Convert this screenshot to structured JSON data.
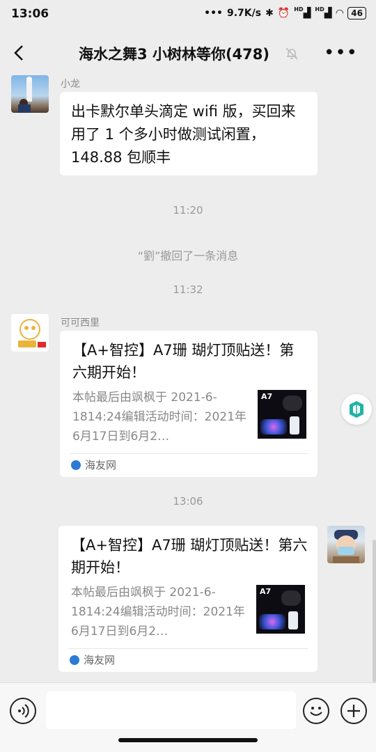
{
  "status_bar": {
    "time": "13:06",
    "network_speed": "9.7K/s",
    "hd1": "HD",
    "hd2": "HD",
    "battery": "46"
  },
  "header": {
    "title": "海水之舞3 小树林等你(478)"
  },
  "messages": {
    "m1": {
      "sender": "小龙",
      "text": "出卡默尔单头滴定 wifi 版，买回来用了 1 个多小时做测试闲置，148.88 包顺丰"
    },
    "t1": "11:20",
    "recall": "“劉”撤回了一条消息",
    "t2": "11:32",
    "m2": {
      "sender": "可可西里",
      "card_title": "【A+智控】A7珊 瑚灯顶贴送！第六期开始！",
      "card_desc": "本帖最后由飒枫于 2021-6-1814:24编辑活动时间：2021年6月17日到6月2…",
      "thumb_label": "A7",
      "source": "海友网"
    },
    "t3": "13:06",
    "m3": {
      "card_title": "【A+智控】A7珊 瑚灯顶贴送！第六期开始！",
      "card_desc": "本帖最后由飒枫于 2021-6-1814:24编辑活动时间：2021年6月17日到6月2…",
      "thumb_label": "A7",
      "source": "海友网"
    }
  },
  "input": {
    "placeholder": ""
  },
  "colors": {
    "background": "#ededed",
    "bubble": "#ffffff",
    "meta_text": "#999999"
  }
}
